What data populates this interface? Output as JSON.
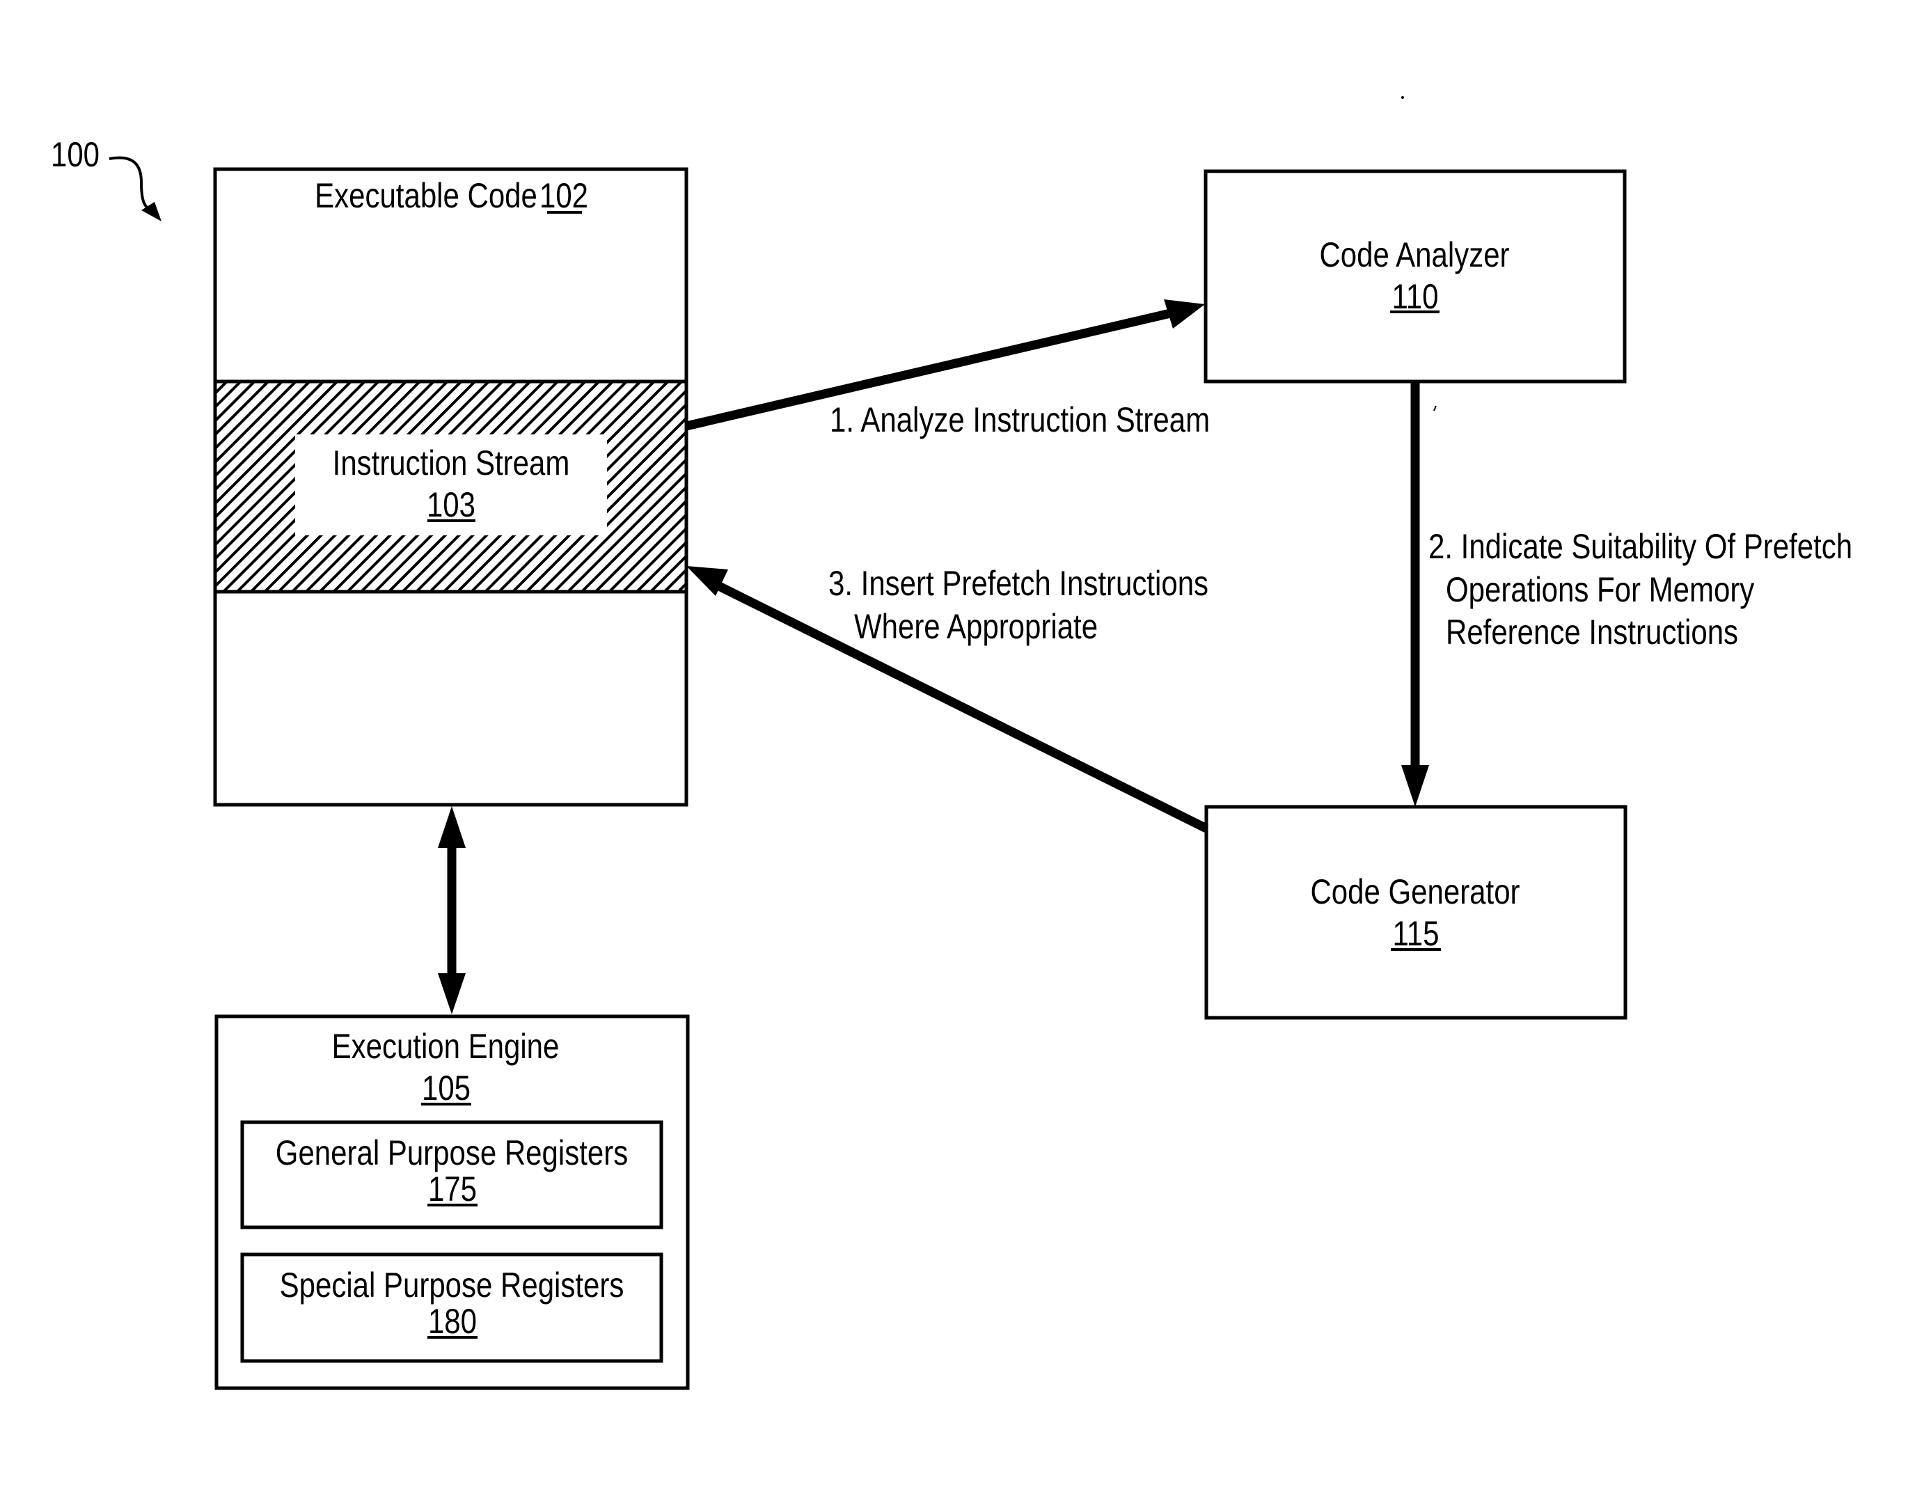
{
  "figure": {
    "reference_number": "100"
  },
  "components": {
    "executable_code": {
      "title": "Executable Code",
      "ref": "102"
    },
    "instruction_stream": {
      "title": "Instruction Stream",
      "ref": "103"
    },
    "execution_engine": {
      "title": "Execution Engine",
      "ref": "105"
    },
    "general_purpose_registers": {
      "title": "General Purpose Registers",
      "ref": "175"
    },
    "special_purpose_registers": {
      "title": "Special Purpose Registers",
      "ref": "180"
    },
    "code_analyzer": {
      "title": "Code Analyzer",
      "ref": "110"
    },
    "code_generator": {
      "title": "Code Generator",
      "ref": "115"
    }
  },
  "flows": {
    "step1": {
      "lines": [
        "1. Analyze Instruction Stream"
      ],
      "from": "Instruction Stream",
      "to": "Code Analyzer"
    },
    "step2": {
      "lines": [
        "2. Indicate Suitability Of Prefetch",
        "Operations For Memory",
        "Reference Instructions"
      ],
      "from": "Code Analyzer",
      "to": "Code Generator"
    },
    "step3": {
      "lines": [
        "3. Insert Prefetch Instructions",
        "Where Appropriate"
      ],
      "from": "Code Generator",
      "to": "Instruction Stream"
    },
    "bidirectional": {
      "between": [
        "Executable Code",
        "Execution Engine"
      ]
    }
  }
}
